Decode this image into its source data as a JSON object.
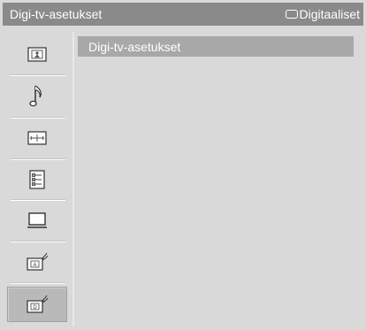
{
  "header": {
    "title": "Digi-tv-asetukset",
    "input_label": "Digitaaliset",
    "input_icon": "input-source-icon"
  },
  "sidebar": {
    "items": [
      {
        "icon": "picture-icon",
        "selected": false
      },
      {
        "icon": "music-note-icon",
        "selected": false
      },
      {
        "icon": "screen-settings-icon",
        "selected": false
      },
      {
        "icon": "features-list-icon",
        "selected": false
      },
      {
        "icon": "pc-settings-icon",
        "selected": false
      },
      {
        "icon": "analog-setup-icon",
        "selected": false
      },
      {
        "icon": "digital-setup-icon",
        "selected": true
      }
    ]
  },
  "main": {
    "items": [
      {
        "label": "Digi-tv-asetukset",
        "highlighted": true
      }
    ]
  },
  "colors": {
    "title_bar": "#8a8a8a",
    "background": "#d9d9d9",
    "highlight": "#a8a8a8",
    "selected_item": "#b9b9b9"
  }
}
